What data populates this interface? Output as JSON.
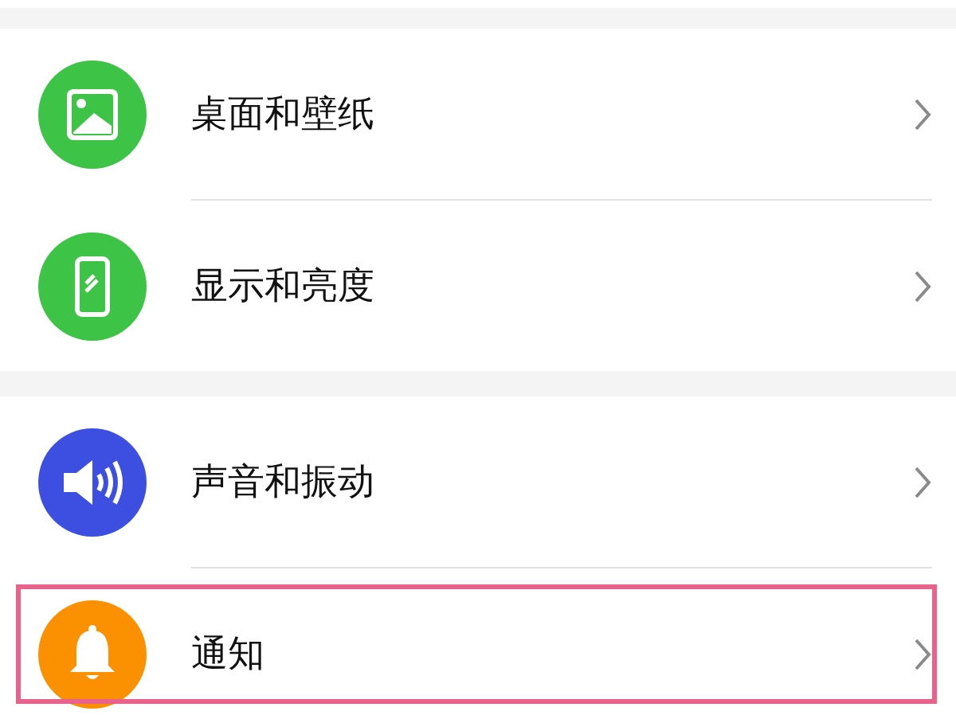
{
  "groups": [
    {
      "items": [
        {
          "label": "桌面和壁纸",
          "kind": "image",
          "color": "#3dc346",
          "highlighted": false
        },
        {
          "label": "显示和亮度",
          "kind": "phone",
          "color": "#3dc346",
          "highlighted": false
        }
      ]
    },
    {
      "items": [
        {
          "label": "声音和振动",
          "kind": "speaker",
          "color": "#3d4fe0",
          "highlighted": false
        },
        {
          "label": "通知",
          "kind": "bell",
          "color": "#fb9100",
          "highlighted": true
        }
      ]
    }
  ]
}
